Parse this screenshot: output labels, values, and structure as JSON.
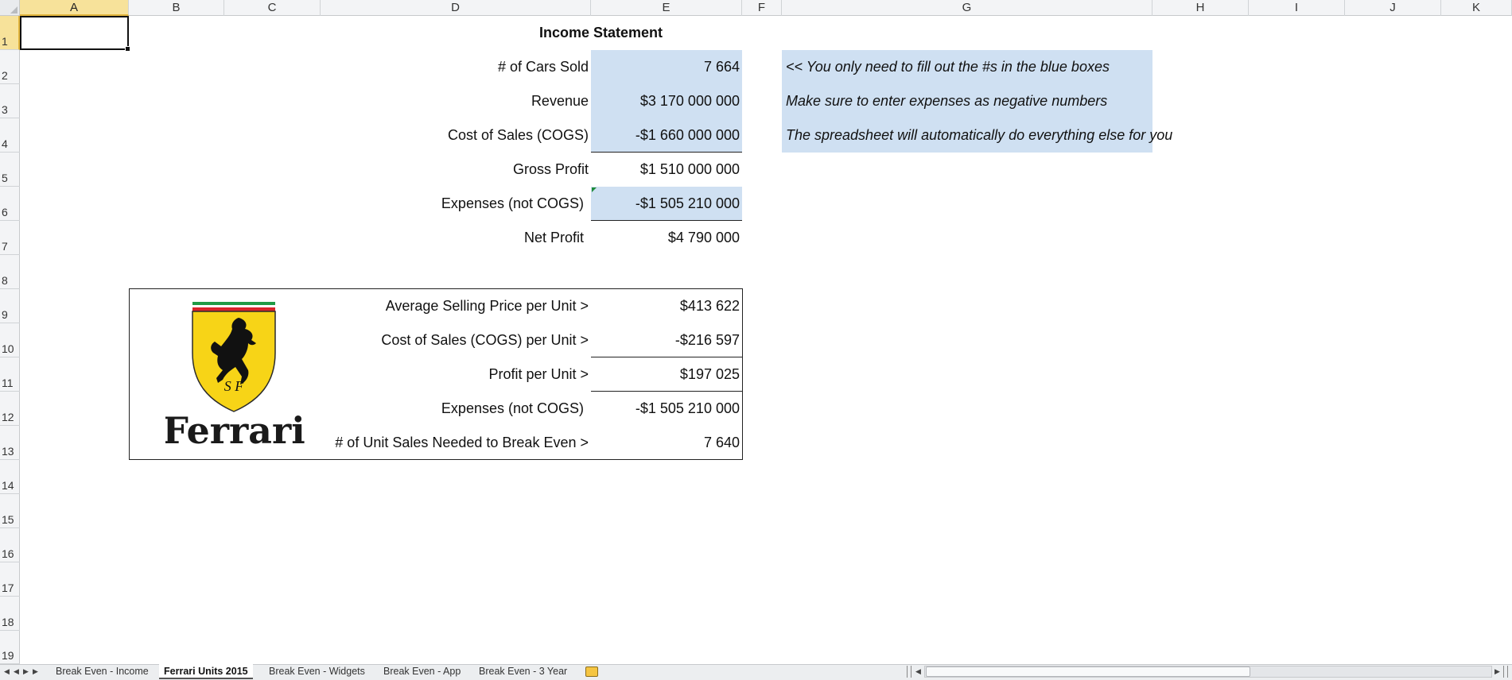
{
  "columns": [
    "A",
    "B",
    "C",
    "D",
    "E",
    "F",
    "G",
    "H",
    "I",
    "J",
    "K"
  ],
  "rows": [
    "1",
    "2",
    "3",
    "4",
    "5",
    "6",
    "7",
    "8",
    "9",
    "10",
    "11",
    "12",
    "13",
    "14",
    "15",
    "16",
    "17",
    "18",
    "19"
  ],
  "income": {
    "title": "Income Statement",
    "cars_sold_label": "# of Cars Sold",
    "cars_sold_value": "7 664",
    "revenue_label": "Revenue",
    "revenue_value": "$3 170 000 000",
    "cogs_label": "Cost of Sales (COGS)",
    "cogs_value": "-$1 660 000 000",
    "gross_label": "Gross Profit",
    "gross_value": "$1 510 000 000",
    "expenses_label": "Expenses (not COGS)",
    "expenses_value": "-$1 505 210 000",
    "net_label": "Net Profit",
    "net_value": "$4 790 000"
  },
  "notes": {
    "line1": "<< You only need to fill out the #s in the blue boxes",
    "line2": "Make sure to enter expenses as negative numbers",
    "line3": "The spreadsheet will automatically do everything else for you"
  },
  "breakeven": {
    "logo_text": "Ferrari",
    "logo_initials": "S F",
    "asp_label": "Average Selling Price per Unit >",
    "asp_value": "$413 622",
    "cogs_unit_label": "Cost of Sales (COGS) per Unit >",
    "cogs_unit_value": "-$216 597",
    "profit_unit_label": "Profit per Unit >",
    "profit_unit_value": "$197 025",
    "expenses_label": "Expenses (not COGS)",
    "expenses_value": "-$1 505 210 000",
    "units_label": "# of Unit Sales Needed to Break Even >",
    "units_value": "7 640"
  },
  "tabs": [
    "Break Even - Income",
    "Ferrari Units 2015",
    "Break Even - Widgets",
    "Break Even - App",
    "Break Even - 3 Year"
  ],
  "active_tab": "Ferrari Units 2015",
  "colors": {
    "input_fill": "#cfe0f2",
    "selected_header": "#f7e29a",
    "ferrari_yellow": "#f7d417"
  },
  "icons": [
    "first-sheet-icon",
    "prev-sheet-icon",
    "next-sheet-icon",
    "last-sheet-icon",
    "new-sheet-icon"
  ]
}
